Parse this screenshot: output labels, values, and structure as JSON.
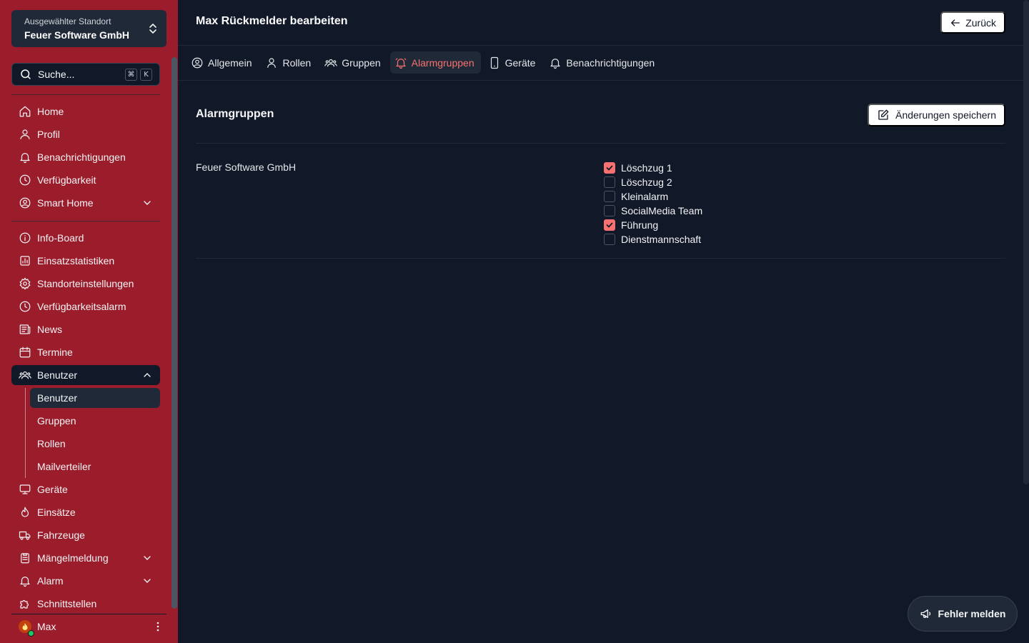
{
  "site": {
    "label": "Ausgewählter Standort",
    "value": "Feuer Software GmbH"
  },
  "search": {
    "placeholder": "Suche...",
    "kbd1": "⌘",
    "kbd2": "K"
  },
  "nav": {
    "home": "Home",
    "profile": "Profil",
    "notifications": "Benachrichtigungen",
    "availability": "Verfügbarkeit",
    "smart_home": "Smart Home",
    "info_board": "Info-Board",
    "stats": "Einsatzstatistiken",
    "site_settings": "Standorteinstellungen",
    "availability_alarm": "Verfügbarkeitsalarm",
    "news": "News",
    "events": "Termine",
    "users": "Benutzer",
    "devices": "Geräte",
    "missions": "Einsätze",
    "vehicles": "Fahrzeuge",
    "defects": "Mängelmeldung",
    "alarm": "Alarm",
    "interfaces": "Schnittstellen"
  },
  "users_sub": {
    "users": "Benutzer",
    "groups": "Gruppen",
    "roles": "Rollen",
    "mail": "Mailverteiler"
  },
  "user": {
    "name": "Max"
  },
  "header": {
    "title": "Max Rückmelder bearbeiten",
    "back": "Zurück"
  },
  "tabs": {
    "general": "Allgemein",
    "roles": "Rollen",
    "groups": "Gruppen",
    "alarm_groups": "Alarmgruppen",
    "devices": "Geräte",
    "notifications": "Benachrichtigungen"
  },
  "section": {
    "title": "Alarmgruppen",
    "save": "Änderungen speichern",
    "org": "Feuer Software GmbH"
  },
  "alarm_groups": [
    {
      "label": "Löschzug 1",
      "checked": true
    },
    {
      "label": "Löschzug 2",
      "checked": false
    },
    {
      "label": "Kleinalarm",
      "checked": false
    },
    {
      "label": "SocialMedia Team",
      "checked": false
    },
    {
      "label": "Führung",
      "checked": true
    },
    {
      "label": "Dienstmannschaft",
      "checked": false
    }
  ],
  "report": {
    "label": "Fehler melden"
  },
  "colors": {
    "sidebar": "#9b1c2a",
    "background": "#111827",
    "accent": "#f87171"
  }
}
